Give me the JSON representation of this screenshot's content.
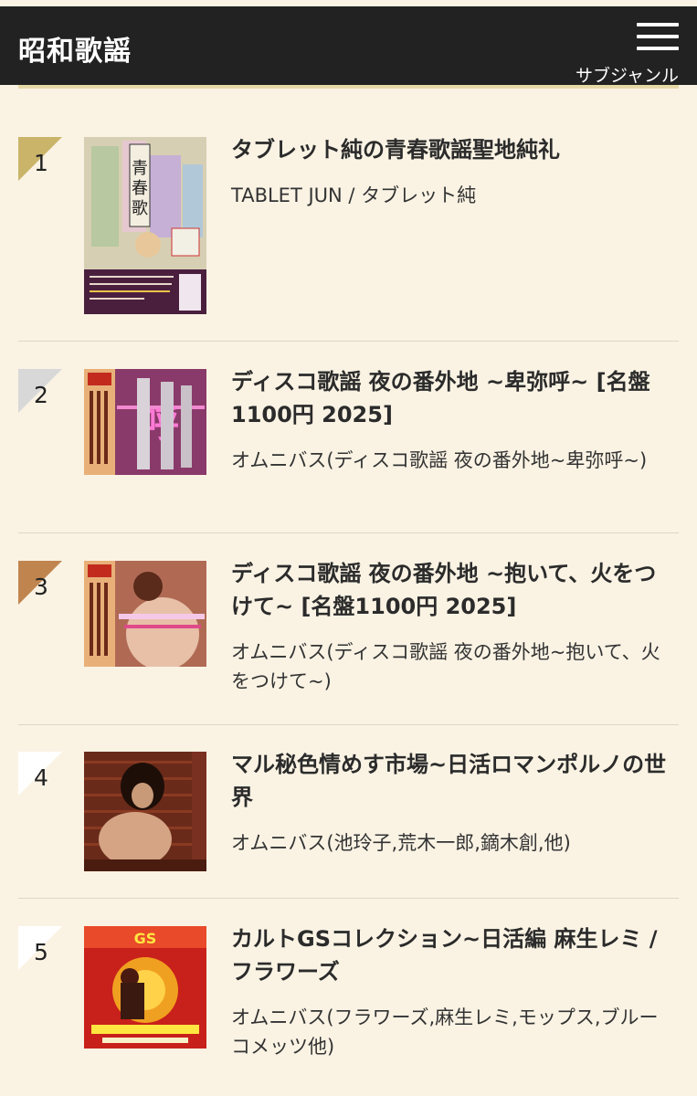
{
  "header": {
    "title": "昭和歌謡",
    "menu_label": "サブジャンル"
  },
  "items": [
    {
      "rank": "1",
      "title": "タブレット純の青春歌謡聖地純礼",
      "artist": "TABLET JUN / タブレット純",
      "badge_color": "#c9b46a"
    },
    {
      "rank": "2",
      "title": "ディスコ歌謡 夜の番外地 ~卑弥呼~ [名盤1100円 2025]",
      "artist": "オムニバス(ディスコ歌謡 夜の番外地~卑弥呼~)",
      "badge_color": "#d8d8d8"
    },
    {
      "rank": "3",
      "title": "ディスコ歌謡 夜の番外地 ~抱いて、火をつけて~ [名盤1100円 2025]",
      "artist": "オムニバス(ディスコ歌謡 夜の番外地~抱いて、火をつけて~)",
      "badge_color": "#c0854f"
    },
    {
      "rank": "4",
      "title": "マル秘色情めす市場~日活ロマンポルノの世界",
      "artist": "オムニバス(池玲子,荒木一郎,鏑木創,他)",
      "badge_color": "#ffffff"
    },
    {
      "rank": "5",
      "title": "カルトGSコレクション~日活編 麻生レミ / フラワーズ",
      "artist": "オムニバス(フラワーズ,麻生レミ,モップス,ブルーコメッツ他)",
      "badge_color": "#ffffff"
    }
  ]
}
